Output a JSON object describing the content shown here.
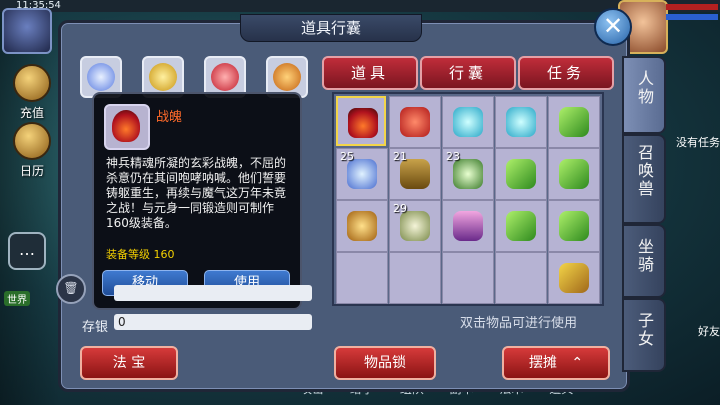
{
  "status": {
    "time": "11:35:54"
  },
  "hud": {
    "left_items": [
      "充值",
      "日历"
    ],
    "world_tag": "世界",
    "right_items": [
      "没有任务",
      "好友"
    ],
    "bottom_menu": [
      "攻击",
      "给予",
      "组队",
      "副本",
      "法术",
      "道具"
    ]
  },
  "panel": {
    "title": "道具行囊",
    "close_label": "✕",
    "top_tabs": [
      "道具",
      "行囊",
      "任务"
    ],
    "side_tabs": [
      "人物",
      "召唤兽",
      "坐骑",
      "子女"
    ],
    "savings_label": "存银",
    "savings_value": "0",
    "hint": "双击物品可进行使用",
    "buttons": {
      "fabao": "法 宝",
      "lock": "物品锁",
      "stall": "摆摊"
    }
  },
  "tooltip": {
    "name": "战魄",
    "description": "神兵精魂所凝的玄彩战魄，不屈的杀意仍在其间咆哮呐喊。他们誓要铸躯重生，再续与魔气这万年未竟之战！与元身一同锻造则可制作160级装备。",
    "level_label": "装备等级 160",
    "move_label": "移动",
    "use_label": "使用"
  },
  "bag": {
    "rows": [
      [
        {
          "icon": "flame-soul-icon",
          "count": ""
        },
        {
          "icon": "red-bag-icon",
          "count": ""
        },
        {
          "icon": "potion-icon",
          "count": ""
        },
        {
          "icon": "potion-icon",
          "count": ""
        },
        {
          "icon": "green-fan-icon",
          "count": ""
        }
      ],
      [
        {
          "icon": "crystal-icon",
          "count": "25"
        },
        {
          "icon": "box-icon",
          "count": "21"
        },
        {
          "icon": "herb-icon",
          "count": "23"
        },
        {
          "icon": "green-fan-icon",
          "count": ""
        },
        {
          "icon": "green-fan-icon",
          "count": ""
        }
      ],
      [
        {
          "icon": "hat-icon",
          "count": ""
        },
        {
          "icon": "dumpling-icon",
          "count": "29"
        },
        {
          "icon": "gift-box-icon",
          "count": ""
        },
        {
          "icon": "green-fan-icon",
          "count": ""
        },
        {
          "icon": "green-fan-icon",
          "count": ""
        }
      ],
      [
        {
          "icon": "",
          "count": ""
        },
        {
          "icon": "",
          "count": ""
        },
        {
          "icon": "",
          "count": ""
        },
        {
          "icon": "",
          "count": ""
        },
        {
          "icon": "flag-icon",
          "count": ""
        }
      ]
    ]
  }
}
